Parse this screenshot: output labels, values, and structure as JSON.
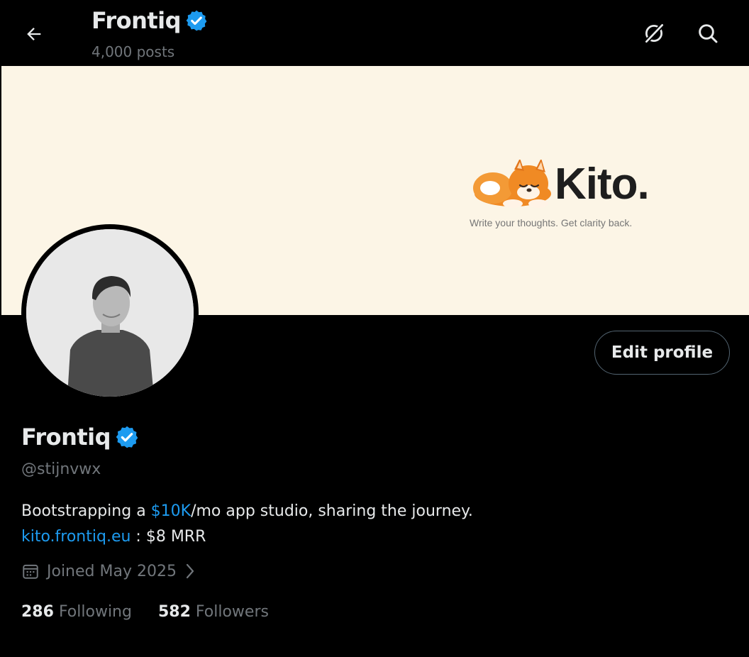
{
  "header": {
    "title": "Frontiq",
    "post_count": "4,000 posts",
    "icons": [
      "back-arrow-icon",
      "verified-badge-icon",
      "grok-icon",
      "search-icon"
    ]
  },
  "banner": {
    "brand_name": "Kito.",
    "tagline": "Write your thoughts. Get clarity back."
  },
  "profile": {
    "edit_button_label": "Edit profile",
    "display_name": "Frontiq",
    "handle": "@stijnvwx",
    "bio": {
      "line1_pre": "Bootstrapping a ",
      "line1_link": "$10K",
      "line1_post": "/mo app studio, sharing the journey.",
      "line2_link": "kito.frontiq.eu",
      "line2_post": " : $8 MRR"
    },
    "joined": "Joined May 2025",
    "following_count": "286",
    "following_label": "Following",
    "followers_count": "582",
    "followers_label": "Followers"
  },
  "colors": {
    "background": "#000000",
    "text_primary": "#e7e9ea",
    "text_secondary": "#71767b",
    "accent_link": "#1d9bf0",
    "verified_badge": "#1d9bf0",
    "banner_background": "#fcf5e6",
    "button_border": "#536471"
  }
}
